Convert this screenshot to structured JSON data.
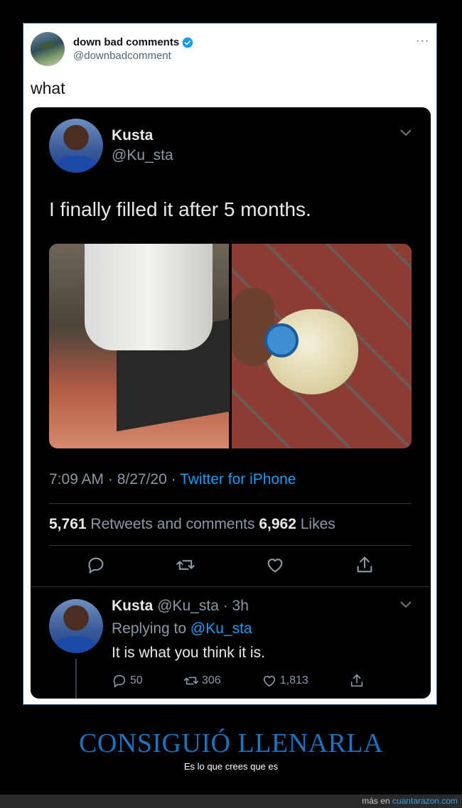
{
  "outer_tweet": {
    "display_name": "down bad comments",
    "handle": "@downbadcomment",
    "more": "···",
    "text": "what"
  },
  "quoted_tweet": {
    "display_name": "Kusta",
    "handle": "@Ku_sta",
    "text": "I finally filled it after 5 months.",
    "time": "7:09 AM · 8/27/20 · ",
    "source": "Twitter for iPhone",
    "retweets_count": "5,761",
    "retweets_label": " Retweets and comments ",
    "likes_count": "6,962",
    "likes_label": " Likes"
  },
  "reply_tweet": {
    "display_name": "Kusta",
    "handle_time": " @Ku_sta · 3h",
    "replying_prefix": "Replying to ",
    "replying_handle": "@Ku_sta",
    "text": "It is what you think it is.",
    "reply_count": "50",
    "retweet_count": "306",
    "like_count": "1,813"
  },
  "caption": {
    "title": "CONSIGUIÓ LLENARLA",
    "subtitle": "Es lo que crees que es"
  },
  "footer": {
    "prefix": "más en ",
    "site": "cuantarazon.com"
  },
  "colors": {
    "accent": "#1d9bf0",
    "caption": "#1e73be",
    "verified": "#1d9bf0"
  }
}
